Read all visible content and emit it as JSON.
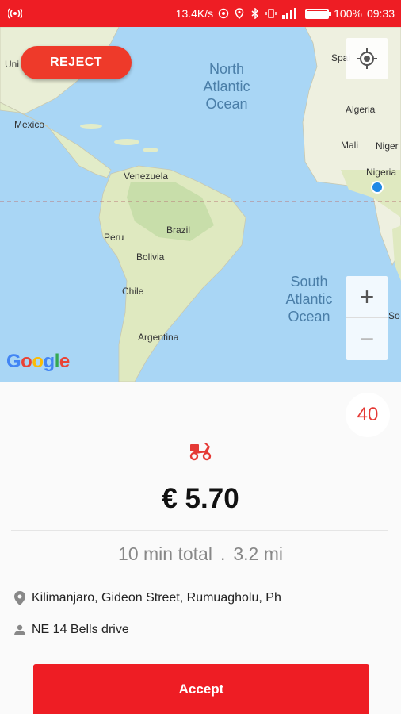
{
  "status_bar": {
    "network_speed": "13.4K/s",
    "battery": "100%",
    "time": "09:33",
    "battery_level": 1.0
  },
  "map": {
    "reject_label": "REJECT",
    "zoom_in": "+",
    "zoom_out": "−",
    "countries": {
      "us": "Uni",
      "mexico": "Mexico",
      "venezuela": "Venezuela",
      "peru": "Peru",
      "brazil": "Brazil",
      "bolivia": "Bolivia",
      "chile": "Chile",
      "argentina": "Argentina",
      "spain": "Spai",
      "algeria": "Algeria",
      "mali": "Mali",
      "niger": "Niger",
      "nigeria": "Nigeria",
      "south_edge": "So"
    },
    "oceans": {
      "north_atlantic": [
        "North",
        "Atlantic",
        "Ocean"
      ],
      "south_atlantic": [
        "South",
        "Atlantic",
        "Ocean"
      ]
    },
    "logo": "Google"
  },
  "order": {
    "countdown": "40",
    "price": "€ 5.70",
    "duration": "10 min total",
    "separator": ".",
    "distance": "3.2 mi",
    "pickup_address": "Kilimanjaro, Gideon Street, Rumuagholu, Ph",
    "dropoff_address": "NE 14 Bells drive",
    "accept_label": "Accept"
  },
  "colors": {
    "brand_red": "#ee1d24",
    "reject_red": "#ee3a2a",
    "countdown_red": "#e53935",
    "ocean": "#a9d6f5",
    "land": "#eef0e0"
  },
  "icons": {
    "location": "map-pin-icon",
    "person": "person-icon",
    "vehicle": "scooter-icon",
    "gps": "crosshair-icon"
  }
}
